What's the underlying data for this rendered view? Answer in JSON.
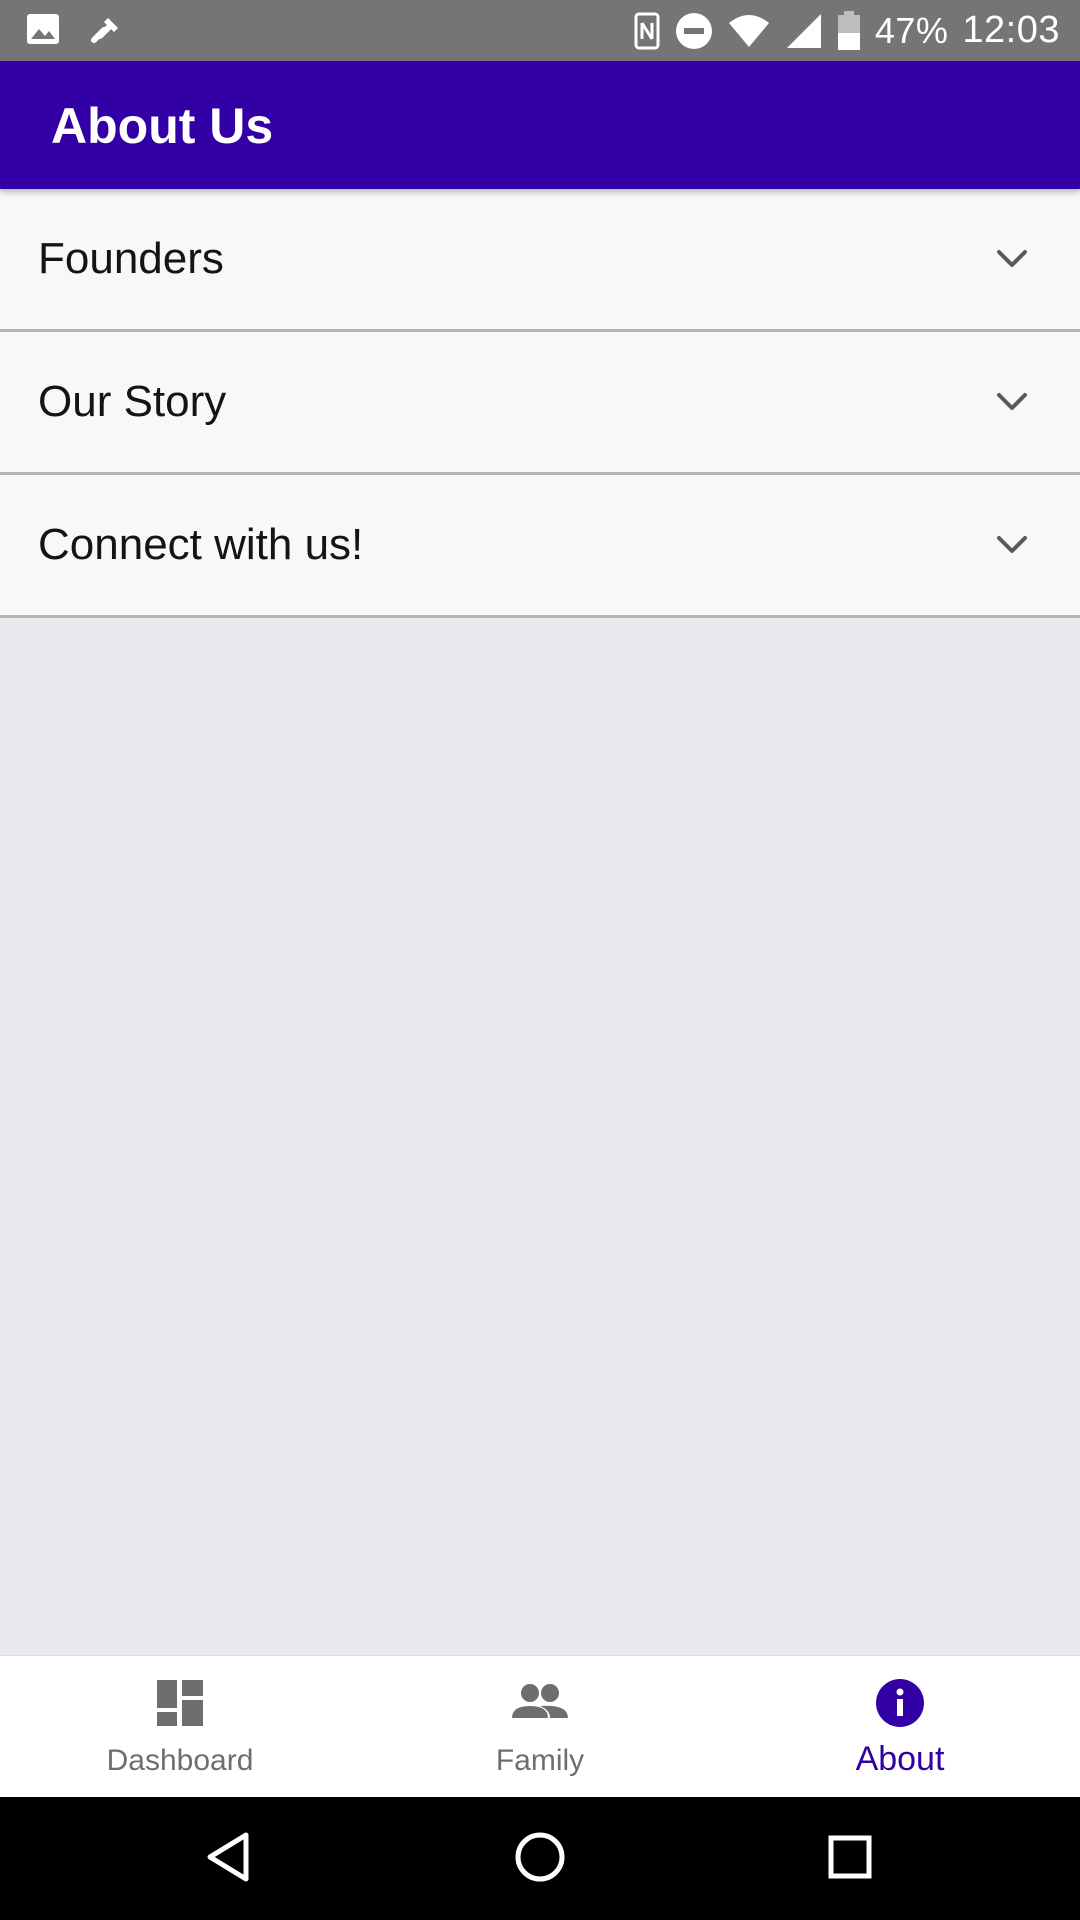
{
  "status_bar": {
    "battery_percent": "47%",
    "time": "12:03",
    "icons": [
      "image-icon",
      "tool-icon",
      "nfc-icon",
      "dnd-icon",
      "wifi-icon",
      "signal-icon",
      "battery-icon"
    ]
  },
  "app_bar": {
    "title": "About Us"
  },
  "accordion": {
    "items": [
      {
        "label": "Founders",
        "icon": "chevron-down-icon"
      },
      {
        "label": "Our Story",
        "icon": "chevron-down-icon"
      },
      {
        "label": "Connect with us!",
        "icon": "chevron-down-icon"
      }
    ]
  },
  "bottom_nav": {
    "items": [
      {
        "label": "Dashboard",
        "icon": "dashboard-icon",
        "active": false
      },
      {
        "label": "Family",
        "icon": "people-icon",
        "active": false
      },
      {
        "label": "About",
        "icon": "info-icon",
        "active": true
      }
    ]
  },
  "system_nav": {
    "icons": [
      "back-icon",
      "home-icon",
      "recents-icon"
    ]
  },
  "colors": {
    "primary": "#3300a5",
    "status_bar": "#757575",
    "background": "#e9e8ee",
    "inactive": "#6e6e6e"
  }
}
